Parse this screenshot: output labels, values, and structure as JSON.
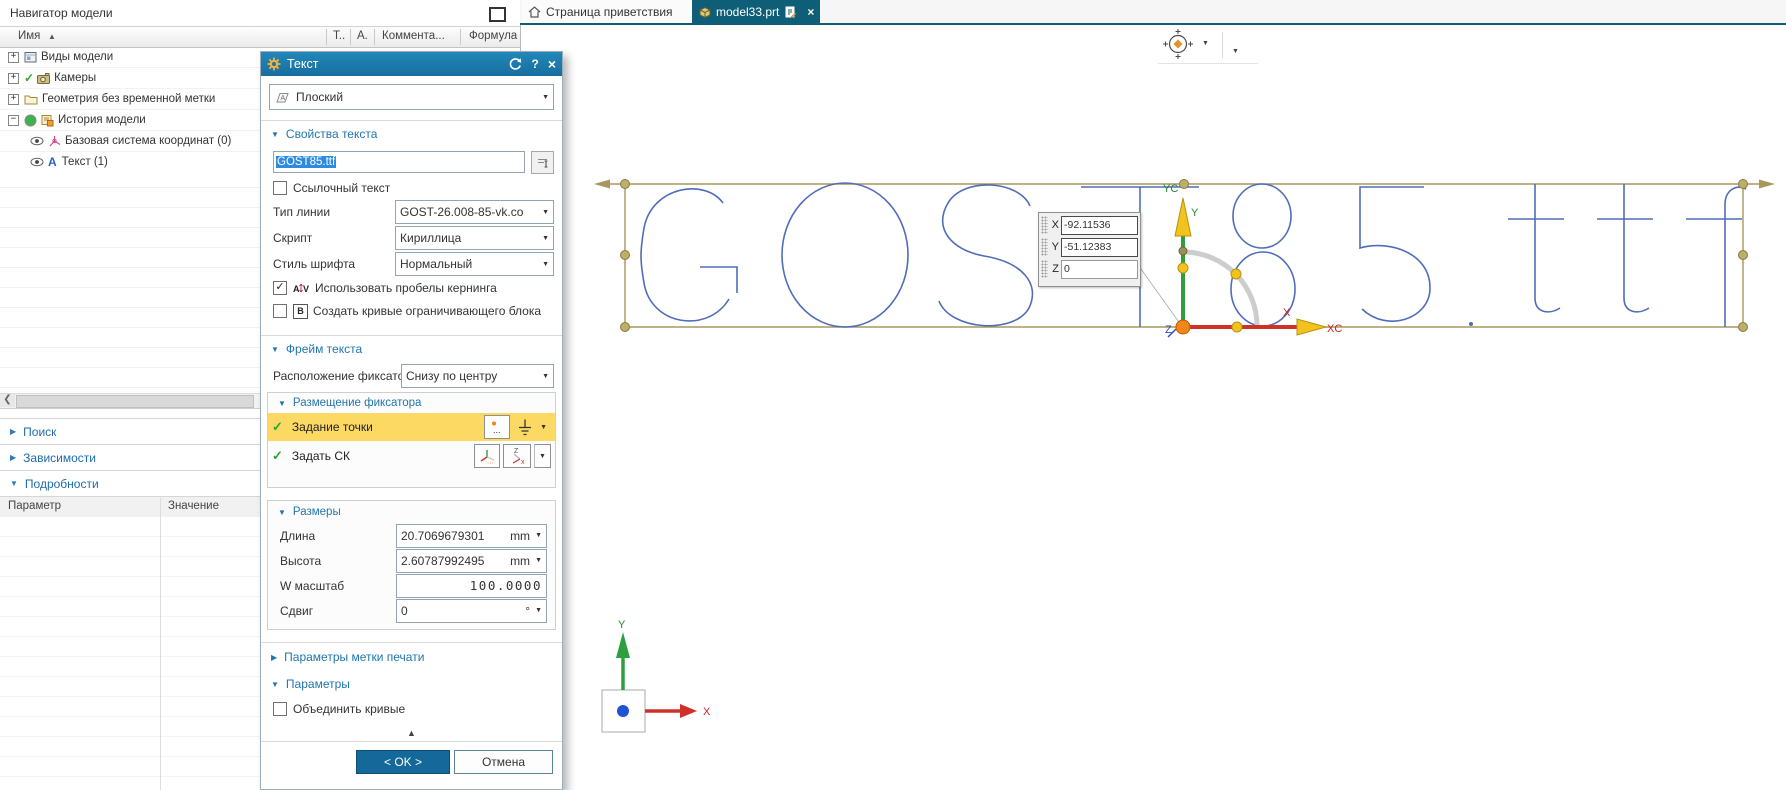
{
  "colors": {
    "dialog_header": "#1b7aad",
    "accent_blue": "#2276ad",
    "highlight_yellow": "#fbd963",
    "ok_button": "#14699a",
    "active_tab": "#0f5e78",
    "frame_tan": "#a6985e",
    "curve_blue": "#4f6db8",
    "selection_blue": "#2f8be0"
  },
  "navigator": {
    "title": "Навигатор модели",
    "columns": {
      "name": "Имя",
      "t": "Т..",
      "a": "А.",
      "comment": "Коммента...",
      "formula": "Формула"
    },
    "tree": [
      {
        "label": "Виды модели"
      },
      {
        "label": "Камеры"
      },
      {
        "label": "Геометрия без временной метки"
      },
      {
        "label": "История модели"
      },
      {
        "label": "Базовая система координат (0)"
      },
      {
        "label": "Текст (1)"
      }
    ],
    "sections": [
      {
        "label": "Поиск"
      },
      {
        "label": "Зависимости"
      },
      {
        "label": "Подробности"
      }
    ],
    "details": {
      "param_col": "Параметр",
      "value_col": "Значение"
    }
  },
  "tabs": {
    "welcome": "Страница приветствия",
    "part": "model33.prt"
  },
  "dialog": {
    "title": "Текст",
    "type_value": "Плоский",
    "text_properties": {
      "header": "Свойства текста",
      "text_value": "GOST85.ttf",
      "reference_text": "Ссылочный текст",
      "line_type_label": "Тип линии",
      "line_type_value": "GOST-26.008-85-vk.co",
      "script_label": "Скрипт",
      "script_value": "Кириллица",
      "font_style_label": "Стиль шрифта",
      "font_style_value": "Нормальный",
      "kerning_label": "Использовать пробелы кернинга",
      "bounding_icon": "B",
      "bounding_label": "Создать кривые ограничивающего блока"
    },
    "text_frame": {
      "header": "Фрейм текста",
      "anchor_location_label": "Расположение фиксатора",
      "anchor_location_value": "Снизу по центру",
      "anchor_placement": {
        "header": "Размещение фиксатора",
        "specify_point": "Задание точки",
        "specify_csys": "Задать СК"
      },
      "size": {
        "header": "Размеры",
        "length_label": "Длина",
        "length_value": "20.7069679301",
        "length_unit": "mm",
        "height_label": "Высота",
        "height_value": "2.60787992495",
        "height_unit": "mm",
        "wscale_label": "W масштаб",
        "wscale_value": "100.0000",
        "shear_label": "Сдвиг",
        "shear_value": "0",
        "shear_unit": "°"
      }
    },
    "print_mark_header": "Параметры метки печати",
    "settings": {
      "header": "Параметры",
      "join_curves": "Объединить кривые"
    },
    "ok_label": "< OK >",
    "cancel_label": "Отмена"
  },
  "viewport": {
    "sketch_text": "GOST85.ttf",
    "coord_box": {
      "x_label": "X",
      "x_value": "-92.11536",
      "y_label": "Y",
      "y_value": "-51.12383",
      "z_label": "Z",
      "z_value": "0"
    },
    "wcs": {
      "y": "Y",
      "yc": "YC",
      "x": "X",
      "xc": "XC",
      "z": "Z"
    },
    "triad": {
      "x": "X",
      "y": "Y"
    }
  }
}
